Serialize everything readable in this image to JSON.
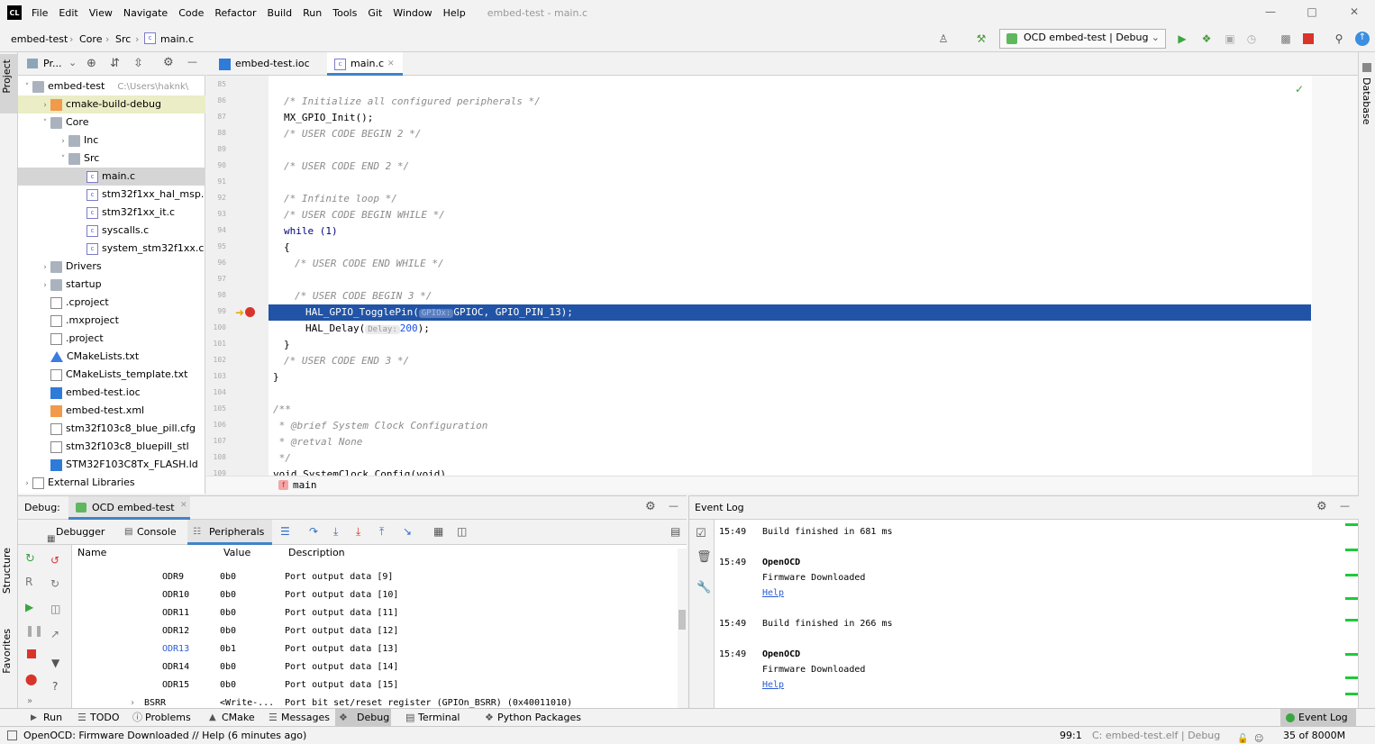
{
  "app": {
    "logo": "CL",
    "menu": [
      "File",
      "Edit",
      "View",
      "Navigate",
      "Code",
      "Refactor",
      "Build",
      "Run",
      "Tools",
      "Git",
      "Window",
      "Help"
    ],
    "window_title": "embed-test - main.c"
  },
  "navbar": {
    "breadcrumbs": [
      "embed-test",
      "Core",
      "Src",
      "main.c"
    ],
    "run_config": "OCD embed-test | Debug"
  },
  "left_strip": {
    "project": "Project",
    "structure": "Structure",
    "favorites": "Favorites"
  },
  "right_strip": {
    "database": "Database"
  },
  "project_panel": {
    "title": "Pr...",
    "tree": [
      {
        "label": "embed-test",
        "extra": "C:\\Users\\haknk\\",
        "depth": 0,
        "type": "folder",
        "expanded": true
      },
      {
        "label": "cmake-build-debug",
        "depth": 1,
        "type": "folder-orange",
        "expanded": false
      },
      {
        "label": "Core",
        "depth": 1,
        "type": "folder",
        "expanded": true
      },
      {
        "label": "Inc",
        "depth": 2,
        "type": "folder",
        "expanded": false
      },
      {
        "label": "Src",
        "depth": 2,
        "type": "folder",
        "expanded": true
      },
      {
        "label": "main.c",
        "depth": 3,
        "type": "c",
        "selected": true
      },
      {
        "label": "stm32f1xx_hal_msp.",
        "depth": 3,
        "type": "c"
      },
      {
        "label": "stm32f1xx_it.c",
        "depth": 3,
        "type": "c"
      },
      {
        "label": "syscalls.c",
        "depth": 3,
        "type": "c"
      },
      {
        "label": "system_stm32f1xx.c",
        "depth": 3,
        "type": "c"
      },
      {
        "label": "Drivers",
        "depth": 1,
        "type": "folder",
        "expanded": false
      },
      {
        "label": "startup",
        "depth": 1,
        "type": "folder",
        "expanded": false
      },
      {
        "label": ".cproject",
        "depth": 1,
        "type": "txt"
      },
      {
        "label": ".mxproject",
        "depth": 1,
        "type": "txt"
      },
      {
        "label": ".project",
        "depth": 1,
        "type": "txt"
      },
      {
        "label": "CMakeLists.txt",
        "depth": 1,
        "type": "cmake"
      },
      {
        "label": "CMakeLists_template.txt",
        "depth": 1,
        "type": "txt"
      },
      {
        "label": "embed-test.ioc",
        "depth": 1,
        "type": "ioc"
      },
      {
        "label": "embed-test.xml",
        "depth": 1,
        "type": "xml"
      },
      {
        "label": "stm32f103c8_blue_pill.cfg",
        "depth": 1,
        "type": "txt"
      },
      {
        "label": "stm32f103c8_bluepill_stl",
        "depth": 1,
        "type": "txt"
      },
      {
        "label": "STM32F103C8Tx_FLASH.ld",
        "depth": 1,
        "type": "ld"
      },
      {
        "label": "External Libraries",
        "depth": 0,
        "type": "lib",
        "expanded": false
      }
    ]
  },
  "editor": {
    "tabs": [
      {
        "label": "embed-test.ioc",
        "active": false
      },
      {
        "label": "main.c",
        "active": true
      }
    ],
    "lines": [
      {
        "num": "85",
        "text": ""
      },
      {
        "num": "86",
        "text": "/* Initialize all configured peripherals */",
        "cls": "cm",
        "indent": 1
      },
      {
        "num": "87",
        "text": "MX_GPIO_Init();",
        "indent": 1
      },
      {
        "num": "88",
        "text": "/* USER CODE BEGIN 2 */",
        "cls": "cm",
        "indent": 1
      },
      {
        "num": "89",
        "text": ""
      },
      {
        "num": "90",
        "text": "/* USER CODE END 2 */",
        "cls": "cm",
        "indent": 1
      },
      {
        "num": "91",
        "text": ""
      },
      {
        "num": "92",
        "text": "/* Infinite loop */",
        "cls": "cm",
        "indent": 1
      },
      {
        "num": "93",
        "text": "/* USER CODE BEGIN WHILE */",
        "cls": "cm",
        "indent": 1
      },
      {
        "num": "94",
        "text": "while (1)",
        "cls": "kw",
        "indent": 1
      },
      {
        "num": "95",
        "text": "{",
        "indent": 1
      },
      {
        "num": "96",
        "text": "/* USER CODE END WHILE */",
        "cls": "cm",
        "indent": 2
      },
      {
        "num": "97",
        "text": ""
      },
      {
        "num": "98",
        "text": "/* USER CODE BEGIN 3 */",
        "cls": "cm",
        "indent": 2
      },
      {
        "num": "99",
        "text": "",
        "current": true
      },
      {
        "num": "100",
        "text": ""
      },
      {
        "num": "101",
        "text": "}",
        "indent": 1
      },
      {
        "num": "102",
        "text": "/* USER CODE END 3 */",
        "cls": "cm",
        "indent": 1
      },
      {
        "num": "103",
        "text": "}"
      },
      {
        "num": "104",
        "text": ""
      },
      {
        "num": "105",
        "text": "/**",
        "cls": "cm"
      },
      {
        "num": "106",
        "text": " * @brief System Clock Configuration",
        "cls": "cm"
      },
      {
        "num": "107",
        "text": " * @retval None",
        "cls": "cm"
      },
      {
        "num": "108",
        "text": " */",
        "cls": "cm"
      },
      {
        "num": "109",
        "text": "void SystemClock_Config(void)"
      }
    ],
    "line99": {
      "fn": "HAL_GPIO_TogglePin(",
      "hint": "GPIOx:",
      "rest": "GPIOC, GPIO_PIN_13);"
    },
    "line100": {
      "fn": "HAL_Delay(",
      "hint": "Delay:",
      "num": "200",
      "end": ");"
    },
    "bottom_crumb": "main"
  },
  "debug": {
    "label": "Debug:",
    "session": "OCD embed-test",
    "tabs": [
      "Debugger",
      "Console",
      "Peripherals"
    ],
    "active_tab": "Peripherals",
    "columns": [
      "Name",
      "Value",
      "Description"
    ],
    "rows": [
      {
        "name": "ODR9",
        "value": "0b0",
        "desc": "Port output data [9]"
      },
      {
        "name": "ODR10",
        "value": "0b0",
        "desc": "Port output data [10]"
      },
      {
        "name": "ODR11",
        "value": "0b0",
        "desc": "Port output data [11]"
      },
      {
        "name": "ODR12",
        "value": "0b0",
        "desc": "Port output data [12]"
      },
      {
        "name": "ODR13",
        "value": "0b1",
        "desc": "Port output data [13]",
        "changed": true
      },
      {
        "name": "ODR14",
        "value": "0b0",
        "desc": "Port output data [14]"
      },
      {
        "name": "ODR15",
        "value": "0b0",
        "desc": "Port output data [15]"
      },
      {
        "name": "BSRR",
        "value": "<Write-...",
        "desc": "Port bit set/reset register (GPIOn_BSRR) (0x40011010)"
      }
    ]
  },
  "event_log": {
    "title": "Event Log",
    "entries": [
      {
        "time": "15:49",
        "title": "Build finished in 681 ms"
      },
      {
        "time": "15:49",
        "title": "OpenOCD",
        "body": "Firmware Downloaded",
        "link": "Help"
      },
      {
        "time": "15:49",
        "title": "Build finished in 266 ms"
      },
      {
        "time": "15:49",
        "title": "OpenOCD",
        "body": "Firmware Downloaded",
        "link": "Help"
      }
    ]
  },
  "tool_windows": [
    "Run",
    "TODO",
    "Problems",
    "CMake",
    "Messages",
    "Debug",
    "Terminal",
    "Python Packages"
  ],
  "active_tool_window": "Debug",
  "event_log_button": "Event Log",
  "status": {
    "message": "OpenOCD: Firmware Downloaded // Help (6 minutes ago)",
    "position": "99:1",
    "context": "C: embed-test.elf | Debug",
    "memory": "35 of 8000M"
  }
}
